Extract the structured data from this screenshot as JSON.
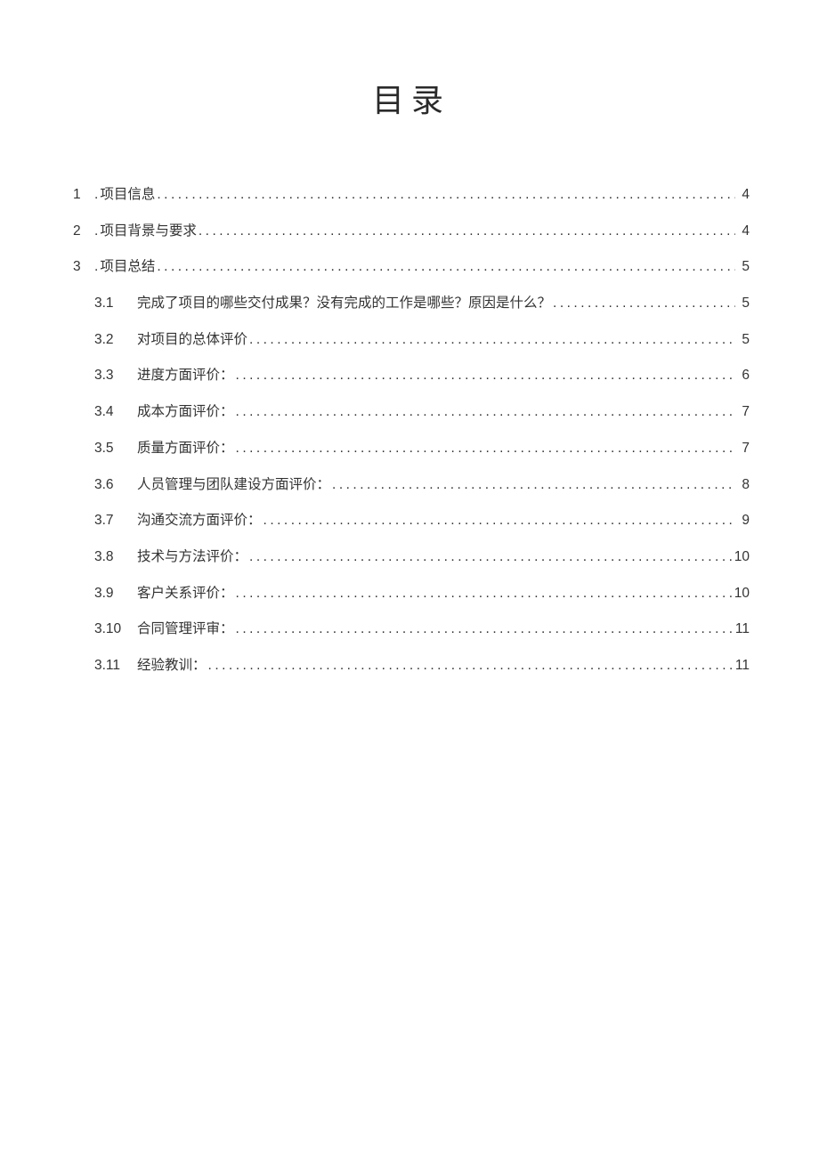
{
  "title": "目录",
  "entries": {
    "main": [
      {
        "num": "1",
        "label": "项目信息",
        "page": "4"
      },
      {
        "num": "2",
        "label": "项目背景与要求",
        "page": "4"
      },
      {
        "num": "3",
        "label": "项目总结",
        "page": "5"
      }
    ],
    "sub": [
      {
        "num": "3.1",
        "label": "完成了项目的哪些交付成果？没有完成的工作是哪些？原因是什么？",
        "page": "5"
      },
      {
        "num": "3.2",
        "label": "对项目的总体评价",
        "page": "5"
      },
      {
        "num": "3.3",
        "label": "进度方面评价：",
        "page": "6"
      },
      {
        "num": "3.4",
        "label": "成本方面评价：",
        "page": "7"
      },
      {
        "num": "3.5",
        "label": "质量方面评价：",
        "page": "7"
      },
      {
        "num": "3.6",
        "label": "人员管理与团队建设方面评价：",
        "page": "8"
      },
      {
        "num": "3.7",
        "label": "沟通交流方面评价：",
        "page": "9"
      },
      {
        "num": "3.8",
        "label": "技术与方法评价：",
        "page": "10"
      },
      {
        "num": "3.9",
        "label": "客户关系评价：",
        "page": "10"
      },
      {
        "num": "3.10",
        "label": "合同管理评审：",
        "page": "11"
      },
      {
        "num": "3.11",
        "label": "经验教训：",
        "page": "11"
      }
    ]
  },
  "dot": "."
}
